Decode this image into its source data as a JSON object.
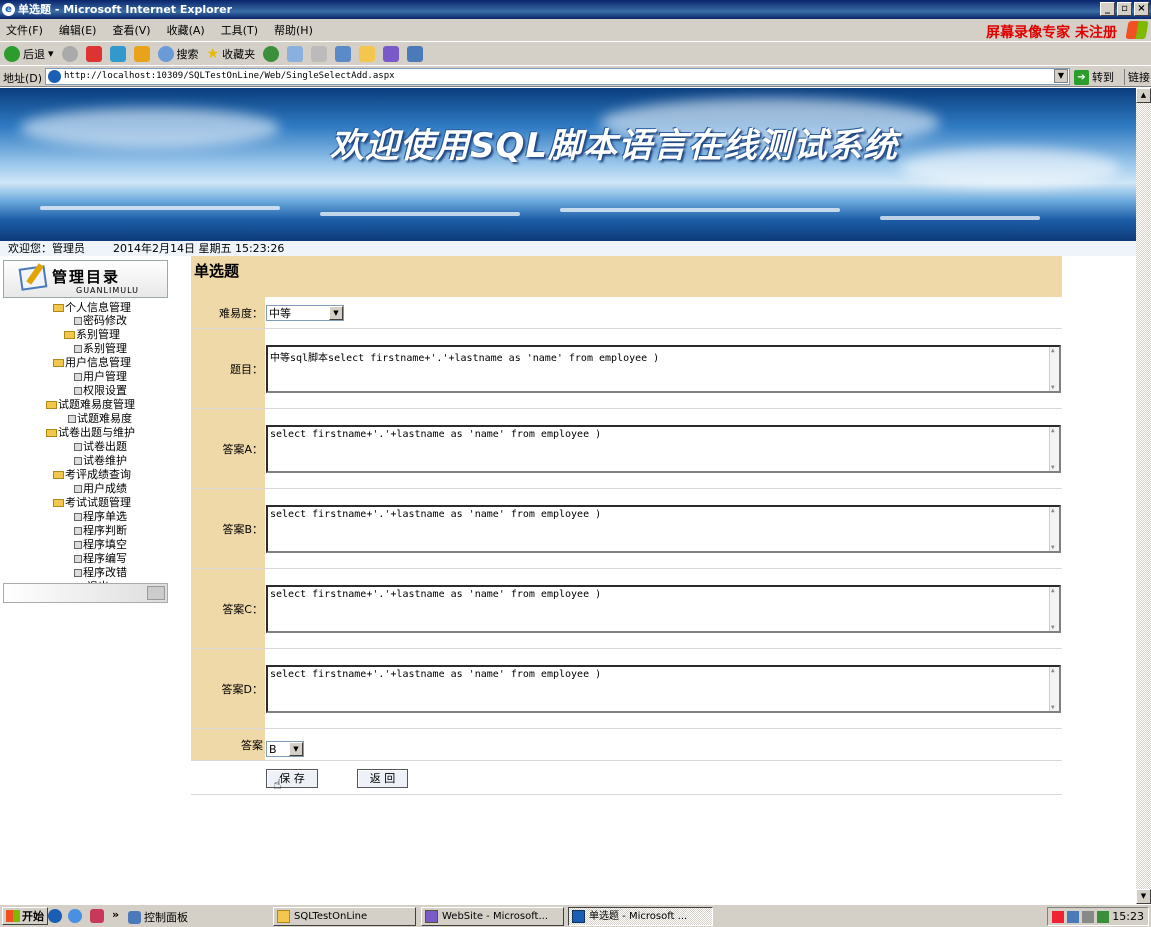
{
  "window": {
    "title": "单选题 - Microsoft Internet Explorer",
    "btn_min": "_",
    "btn_max": "▫",
    "btn_close": "×"
  },
  "menu": [
    "文件(F)",
    "编辑(E)",
    "查看(V)",
    "收藏(A)",
    "工具(T)",
    "帮助(H)"
  ],
  "brand_text": "屏幕录像专家 未注册",
  "toolbar": {
    "back": "后退",
    "search": "搜索",
    "favorites": "收藏夹"
  },
  "address": {
    "label": "地址(D)",
    "url": "http://localhost:10309/SQLTestOnLine/Web/SingleSelectAdd.aspx",
    "go": "转到",
    "links": "链接"
  },
  "banner_title": "欢迎使用SQL脚本语言在线测试系统",
  "info": {
    "welcome": "欢迎您：管理员",
    "datetime": "2014年2月14日 星期五 15:23:26"
  },
  "sidebar": {
    "title": "管理目录",
    "subtitle": "GUANLIMULU",
    "items": [
      {
        "label": "个人信息管理",
        "type": "folder"
      },
      {
        "label": "密码修改",
        "type": "leaf"
      },
      {
        "label": "系别管理",
        "type": "folder"
      },
      {
        "label": "系别管理",
        "type": "leaf"
      },
      {
        "label": "用户信息管理",
        "type": "folder"
      },
      {
        "label": "用户管理",
        "type": "leaf"
      },
      {
        "label": "权限设置",
        "type": "leaf"
      },
      {
        "label": "试题难易度管理",
        "type": "folder"
      },
      {
        "label": "试题难易度",
        "type": "leaf"
      },
      {
        "label": "试卷出题与维护",
        "type": "folder"
      },
      {
        "label": "试卷出题",
        "type": "leaf"
      },
      {
        "label": "试卷维护",
        "type": "leaf"
      },
      {
        "label": "考评成绩查询",
        "type": "folder"
      },
      {
        "label": "用户成绩",
        "type": "leaf"
      },
      {
        "label": "考试试题管理",
        "type": "folder"
      },
      {
        "label": "程序单选",
        "type": "leaf"
      },
      {
        "label": "程序判断",
        "type": "leaf"
      },
      {
        "label": "程序填空",
        "type": "leaf"
      },
      {
        "label": "程序编写",
        "type": "leaf"
      },
      {
        "label": "程序改错",
        "type": "leaf"
      },
      {
        "label": "退出",
        "type": "leaf"
      }
    ]
  },
  "form": {
    "title": "单选题",
    "difficulty_label": "难易度：",
    "difficulty_value": "中等",
    "question_label": "题目：",
    "question_value": "中等sql脚本select firstname+'.'+lastname as 'name' from employee )",
    "answer_a_label": "答案A：",
    "answer_a_value": "select firstname+'.'+lastname as 'name' from employee )",
    "answer_b_label": "答案B：",
    "answer_b_value": "select firstname+'.'+lastname as 'name' from employee )",
    "answer_c_label": "答案C：",
    "answer_c_value": "select firstname+'.'+lastname as 'name' from employee )",
    "answer_d_label": "答案D：",
    "answer_d_value": "select firstname+'.'+lastname as 'name' from employee )",
    "answer_label": "答案",
    "answer_value": "B",
    "save_label": "保 存",
    "back_label": "返 回"
  },
  "taskbar": {
    "start": "开始",
    "more": "»",
    "control_panel": "控制面板",
    "tasks": [
      "SQLTestOnLine",
      "WebSite - Microsoft...",
      "单选题 - Microsoft ..."
    ],
    "clock": "15:23"
  },
  "colors": {
    "label_bg": "#f0d9a8",
    "title_bar": "#0a246a",
    "brand_red": "#e00000"
  }
}
